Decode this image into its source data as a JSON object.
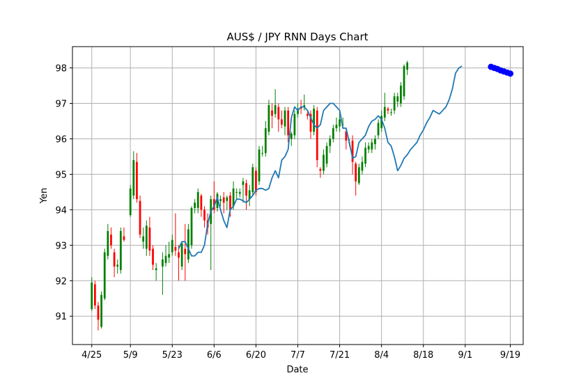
{
  "chart_data": {
    "type": "candlestick",
    "title": "AUS$ / JPY     RNN Days Chart",
    "xlabel": "Date",
    "ylabel": "Yen",
    "ylim": [
      90.2,
      98.6
    ],
    "xlim": [
      -6,
      134
    ],
    "grid": true,
    "x_ticks": [
      {
        "label": "4/25",
        "index": 0
      },
      {
        "label": "5/9",
        "index": 12
      },
      {
        "label": "5/23",
        "index": 25
      },
      {
        "label": "6/6",
        "index": 38
      },
      {
        "label": "6/20",
        "index": 51
      },
      {
        "label": "7/7",
        "index": 64
      },
      {
        "label": "7/21",
        "index": 77
      },
      {
        "label": "8/4",
        "index": 90
      },
      {
        "label": "8/18",
        "index": 103
      },
      {
        "label": "9/1",
        "index": 116
      },
      {
        "label": "9/19",
        "index": 130
      }
    ],
    "y_ticks": [
      91,
      92,
      93,
      94,
      95,
      96,
      97,
      98
    ],
    "colors": {
      "up": "#008000",
      "down": "#ff0000",
      "ma_line": "#1f77b4",
      "forecast": "#0000ff",
      "grid": "#b0b0b0"
    },
    "candles": [
      [
        91.2,
        91.95,
        92.1,
        91.15
      ],
      [
        91.9,
        91.3,
        92.0,
        91.2
      ],
      [
        91.3,
        90.9,
        91.4,
        90.6
      ],
      [
        90.7,
        91.6,
        91.7,
        90.65
      ],
      [
        91.5,
        92.8,
        92.9,
        91.45
      ],
      [
        92.7,
        93.4,
        93.6,
        92.6
      ],
      [
        93.3,
        93.0,
        93.5,
        92.9
      ],
      [
        92.8,
        92.4,
        92.9,
        92.1
      ],
      [
        92.4,
        92.45,
        92.6,
        92.2
      ],
      [
        92.3,
        93.4,
        93.5,
        92.2
      ],
      [
        93.25,
        93.15,
        93.5,
        93.1
      ],
      [
        93.85,
        94.6,
        94.7,
        93.8
      ],
      [
        94.4,
        95.4,
        95.65,
        94.3
      ],
      [
        95.35,
        94.3,
        95.6,
        94.2
      ],
      [
        94.25,
        93.3,
        94.4,
        93.2
      ],
      [
        93.1,
        93.25,
        93.5,
        92.9
      ],
      [
        92.9,
        93.55,
        93.7,
        92.7
      ],
      [
        93.5,
        92.85,
        93.8,
        92.7
      ],
      [
        92.9,
        92.45,
        93.0,
        92.3
      ],
      [
        92.3,
        92.35,
        92.5,
        92.0
      ],
      [
        92.4,
        92.6,
        92.8,
        91.6
      ],
      [
        92.5,
        92.7,
        93.0,
        92.4
      ],
      [
        92.65,
        92.75,
        93.1,
        92.5
      ],
      [
        92.8,
        93.15,
        93.3,
        92.7
      ],
      [
        92.95,
        92.85,
        93.9,
        92.7
      ],
      [
        92.8,
        92.65,
        93.0,
        92.0
      ],
      [
        92.4,
        93.05,
        93.1,
        92.3
      ],
      [
        92.9,
        92.75,
        93.6,
        92.0
      ],
      [
        92.6,
        93.45,
        93.6,
        92.5
      ],
      [
        93.0,
        94.05,
        94.1,
        92.9
      ],
      [
        94.05,
        94.2,
        94.3,
        93.9
      ],
      [
        94.05,
        94.5,
        94.6,
        93.9
      ],
      [
        94.4,
        94.0,
        94.45,
        93.8
      ],
      [
        94.0,
        93.7,
        94.1,
        93.5
      ],
      [
        93.7,
        93.5,
        93.9,
        93.3
      ],
      [
        93.6,
        94.3,
        94.4,
        92.3
      ],
      [
        94.3,
        94.0,
        94.8,
        93.9
      ],
      [
        94.05,
        94.45,
        94.5,
        93.95
      ],
      [
        94.25,
        94.3,
        94.4,
        94.1
      ],
      [
        94.35,
        94.2,
        94.5,
        93.9
      ],
      [
        94.25,
        94.35,
        94.4,
        94.0
      ],
      [
        94.4,
        94.0,
        94.5,
        93.8
      ],
      [
        94.1,
        94.6,
        94.8,
        94.0
      ],
      [
        94.5,
        94.5,
        94.6,
        94.3
      ],
      [
        94.45,
        94.5,
        94.6,
        94.35
      ],
      [
        94.7,
        94.8,
        94.9,
        94.2
      ],
      [
        94.75,
        94.4,
        94.85,
        94.0
      ],
      [
        94.3,
        94.55,
        94.7,
        94.1
      ],
      [
        94.5,
        95.2,
        95.3,
        94.4
      ],
      [
        95.1,
        94.5,
        95.2,
        94.4
      ],
      [
        94.8,
        95.7,
        95.8,
        94.7
      ],
      [
        95.6,
        95.6,
        95.8,
        95.5
      ],
      [
        95.6,
        96.3,
        96.5,
        95.5
      ],
      [
        96.2,
        96.95,
        97.1,
        96.1
      ],
      [
        96.8,
        96.65,
        97.0,
        96.3
      ],
      [
        96.7,
        96.95,
        97.4,
        96.6
      ],
      [
        96.9,
        96.55,
        97.0,
        96.2
      ],
      [
        96.55,
        96.4,
        96.8,
        96.3
      ],
      [
        96.35,
        96.8,
        96.9,
        96.1
      ],
      [
        96.8,
        96.1,
        96.9,
        95.9
      ],
      [
        96.0,
        96.15,
        96.2,
        95.8
      ],
      [
        96.1,
        96.7,
        96.8,
        96.0
      ],
      [
        96.7,
        96.85,
        97.0,
        96.6
      ],
      [
        96.9,
        96.85,
        97.1,
        96.7
      ],
      [
        96.9,
        96.95,
        97.25,
        96.8
      ],
      [
        96.7,
        96.65,
        96.8,
        96.55
      ],
      [
        96.7,
        96.2,
        96.8,
        96.0
      ],
      [
        96.2,
        96.85,
        96.95,
        96.1
      ],
      [
        96.8,
        95.4,
        96.9,
        95.2
      ],
      [
        95.15,
        95.1,
        95.2,
        94.9
      ],
      [
        95.1,
        95.55,
        95.7,
        95.0
      ],
      [
        95.3,
        95.8,
        95.9,
        95.2
      ],
      [
        95.8,
        96.0,
        96.1,
        95.6
      ],
      [
        96.0,
        96.3,
        96.4,
        95.9
      ],
      [
        96.3,
        96.4,
        96.6,
        96.2
      ],
      [
        96.35,
        96.55,
        96.8,
        96.2
      ],
      [
        96.4,
        96.4,
        96.6,
        96.3
      ],
      [
        96.2,
        95.95,
        96.3,
        95.7
      ],
      [
        95.9,
        95.9,
        96.0,
        95.8
      ],
      [
        95.95,
        95.35,
        96.1,
        95.0
      ],
      [
        95.3,
        94.8,
        95.35,
        94.4
      ],
      [
        94.75,
        95.2,
        95.3,
        94.7
      ],
      [
        95.1,
        95.35,
        95.5,
        95.0
      ],
      [
        95.3,
        95.75,
        95.9,
        95.2
      ],
      [
        95.7,
        95.8,
        95.9,
        95.6
      ],
      [
        95.7,
        95.9,
        96.0,
        95.6
      ],
      [
        95.85,
        96.0,
        96.1,
        95.7
      ],
      [
        96.1,
        96.45,
        96.55,
        96.0
      ],
      [
        96.3,
        96.65,
        96.8,
        96.2
      ],
      [
        96.6,
        96.9,
        97.3,
        96.5
      ],
      [
        96.85,
        96.8,
        96.9,
        96.7
      ],
      [
        96.75,
        96.75,
        96.85,
        96.65
      ],
      [
        96.8,
        97.2,
        97.3,
        96.7
      ],
      [
        97.05,
        97.2,
        97.3,
        96.9
      ],
      [
        97.0,
        97.5,
        97.6,
        96.9
      ],
      [
        97.2,
        98.05,
        98.1,
        97.1
      ],
      [
        97.95,
        98.15,
        98.2,
        97.8
      ]
    ],
    "candle_x": [
      0,
      1,
      2,
      3,
      4,
      5,
      6,
      7,
      8,
      9,
      10,
      12,
      13,
      14,
      15,
      16,
      17,
      18,
      19,
      20,
      22,
      23,
      24,
      25,
      26,
      27,
      28,
      29,
      30,
      31,
      32,
      33,
      34,
      35,
      36,
      37,
      38,
      39,
      40,
      41,
      42,
      43,
      44,
      45,
      46,
      47,
      48,
      49,
      50,
      51,
      52,
      53,
      54,
      55,
      56,
      57,
      58,
      59,
      60,
      61,
      62,
      63,
      64,
      65,
      66,
      67,
      68,
      69,
      70,
      71,
      72,
      73,
      74,
      75,
      76,
      77,
      78,
      79,
      80,
      81,
      82,
      83,
      84,
      85,
      86,
      87,
      88,
      89,
      90,
      91,
      92,
      93,
      94,
      95,
      96,
      97,
      98
    ],
    "ma_x": [
      27,
      28,
      29,
      30,
      31,
      32,
      33,
      34,
      35,
      36,
      37,
      38,
      39,
      40,
      41,
      42,
      43,
      44,
      45,
      46,
      47,
      48,
      49,
      50,
      51,
      52,
      53,
      54,
      55,
      56,
      57,
      58,
      59,
      60,
      61,
      62,
      63,
      64,
      65,
      66,
      67,
      68,
      69,
      70,
      71,
      72,
      73,
      74,
      75,
      76,
      77,
      78,
      79,
      80,
      81,
      82,
      83,
      84,
      85,
      86,
      87,
      88,
      89,
      90,
      91,
      92,
      93,
      94,
      95,
      96,
      97,
      98,
      99,
      100,
      101,
      102,
      103,
      104,
      105,
      106,
      107,
      108,
      109,
      110,
      111,
      112,
      113,
      114,
      115,
      116,
      117,
      118,
      119,
      120,
      121,
      122
    ],
    "ma_values": [
      92.9,
      93.1,
      93.1,
      92.9,
      92.7,
      92.7,
      92.8,
      92.8,
      93.0,
      93.6,
      93.95,
      94.1,
      94.35,
      94.0,
      93.7,
      93.5,
      94.0,
      94.1,
      94.3,
      94.3,
      94.25,
      94.2,
      94.3,
      94.4,
      94.55,
      94.6,
      94.6,
      94.55,
      94.6,
      94.9,
      95.1,
      94.9,
      95.4,
      95.5,
      95.7,
      96.6,
      96.9,
      96.8,
      96.9,
      96.9,
      96.8,
      96.6,
      96.4,
      96.3,
      96.4,
      96.8,
      96.9,
      97.0,
      97.0,
      96.9,
      96.8,
      96.3,
      96.3,
      95.9,
      95.45,
      95.5,
      95.9,
      96.0,
      96.1,
      96.35,
      96.5,
      96.55,
      96.65,
      96.55,
      96.3,
      95.9,
      95.8,
      95.5,
      95.1,
      95.25,
      95.45,
      95.55,
      95.7,
      95.8,
      95.9,
      96.1,
      96.25,
      96.45,
      96.6,
      96.8,
      96.75,
      96.7,
      96.8,
      96.9,
      97.1,
      97.4,
      97.85,
      98.0,
      98.05
    ],
    "forecast_x": [
      124,
      125,
      126,
      127,
      128,
      129,
      130
    ],
    "forecast_values": [
      98.03,
      98.0,
      97.97,
      97.93,
      97.9,
      97.87,
      97.84
    ]
  }
}
